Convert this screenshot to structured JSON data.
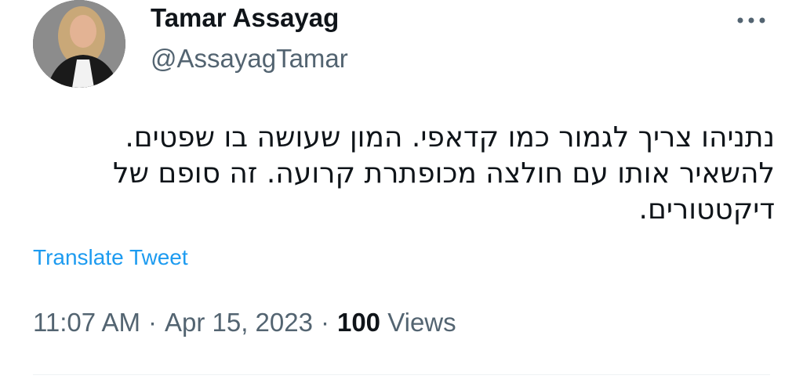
{
  "author": {
    "display_name": "Tamar Assayag",
    "handle": "@AssayagTamar"
  },
  "tweet": {
    "text": "נתניהו צריך לגמור כמו קדאפי. המון שעושה בו שפטים. להשאיר אותו עם חולצה מכופתרת קרועה. זה סופם של דיקטטורים.",
    "translate_label": "Translate Tweet",
    "time": "11:07 AM",
    "date": "Apr 15, 2023",
    "separator": "·",
    "views_count": "100",
    "views_label": "Views"
  },
  "icons": {
    "more": "more-horizontal-icon",
    "avatar": "profile-photo"
  },
  "colors": {
    "link": "#1d9bf0",
    "secondary_text": "#536471",
    "primary_text": "#0f1419"
  }
}
